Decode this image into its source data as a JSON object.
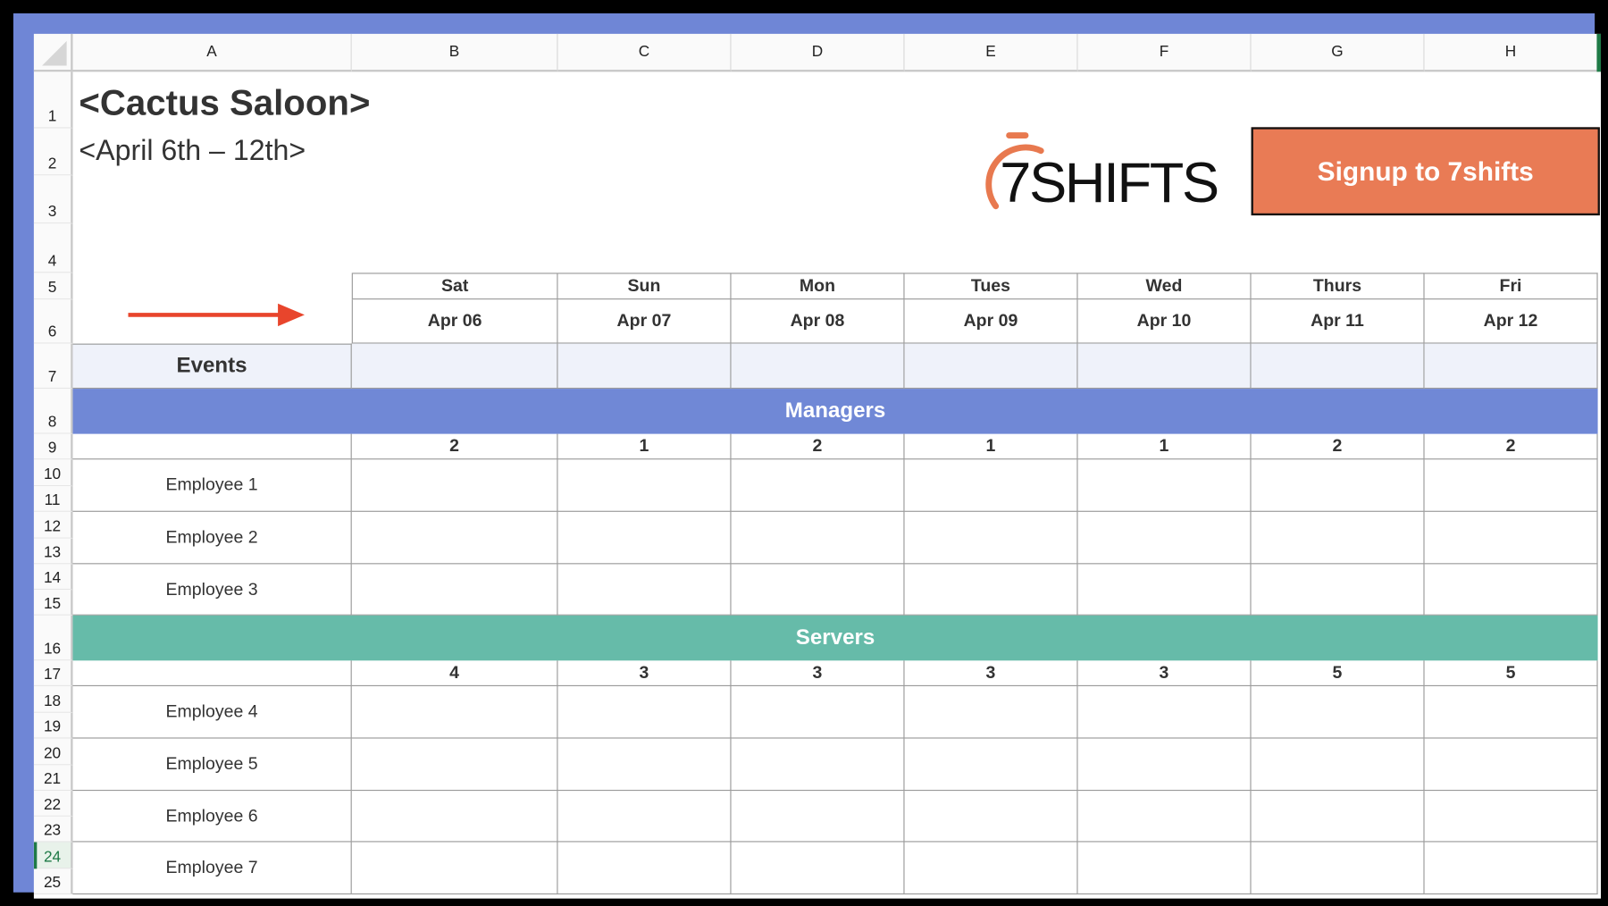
{
  "columns": [
    "A",
    "B",
    "C",
    "D",
    "E",
    "F",
    "G",
    "H"
  ],
  "rows": [
    "1",
    "2",
    "3",
    "4",
    "5",
    "6",
    "7",
    "8",
    "9",
    "10",
    "11",
    "12",
    "13",
    "14",
    "15",
    "16",
    "17",
    "18",
    "19",
    "20",
    "21",
    "22",
    "23",
    "24",
    "25"
  ],
  "selected_row": "24",
  "title": "<Cactus Saloon>",
  "subtitle": "<April 6th – 12th>",
  "logo": {
    "text": "7SHIFTS",
    "accent": "#e8794f"
  },
  "signup_button": {
    "label": "Signup to 7shifts",
    "color": "#e97b55"
  },
  "arrow_color": "#e8452c",
  "days": [
    "Sat",
    "Sun",
    "Mon",
    "Tues",
    "Wed",
    "Thurs",
    "Fri"
  ],
  "dates": [
    "Apr 06",
    "Apr 07",
    "Apr 08",
    "Apr 09",
    "Apr 10",
    "Apr 11",
    "Apr 12"
  ],
  "events_label": "Events",
  "sections": [
    {
      "name": "Managers",
      "color": "#7088d6",
      "counts": [
        "2",
        "1",
        "2",
        "1",
        "1",
        "2",
        "2"
      ],
      "employees": [
        "Employee 1",
        "Employee 2",
        "Employee 3"
      ]
    },
    {
      "name": "Servers",
      "color": "#66bba9",
      "counts": [
        "4",
        "3",
        "3",
        "3",
        "3",
        "5",
        "5"
      ],
      "employees": [
        "Employee 4",
        "Employee 5",
        "Employee 6",
        "Employee 7"
      ]
    }
  ]
}
